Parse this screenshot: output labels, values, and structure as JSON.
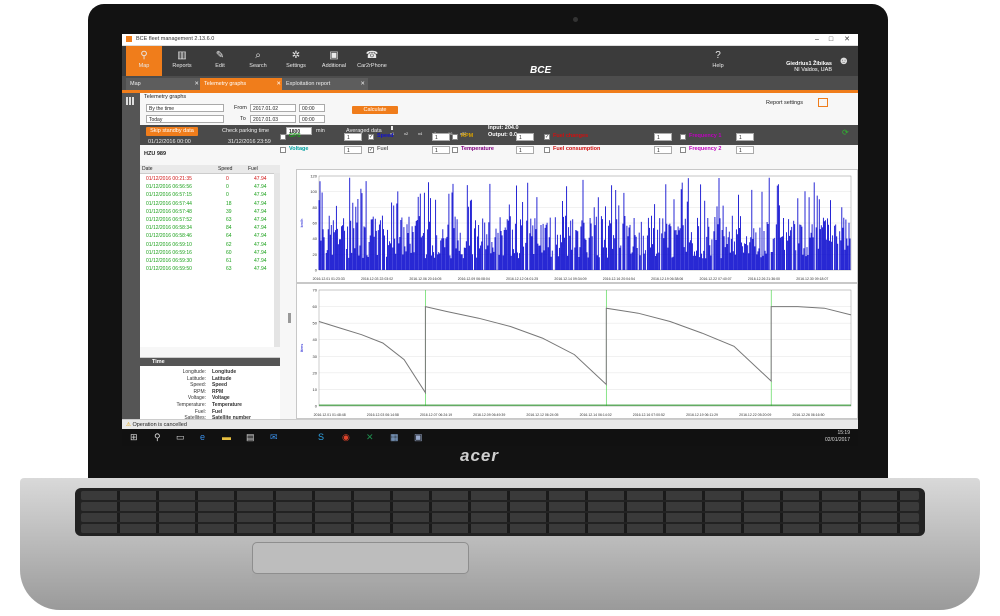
{
  "app": {
    "title": "BCE fleet management 2.13.6.0",
    "brand": "BCE",
    "user_name": "Giedrius1 Žibikas",
    "user_company": "NI Valdos, UAB"
  },
  "ribbon": [
    {
      "label": "Map",
      "icon": "map-pin-icon",
      "glyph": "⚲",
      "active": true
    },
    {
      "label": "Reports",
      "icon": "reports-icon",
      "glyph": "▥"
    },
    {
      "label": "Edit",
      "icon": "edit-icon",
      "glyph": "✎"
    },
    {
      "label": "Search",
      "icon": "search-icon",
      "glyph": "⌕"
    },
    {
      "label": "Settings",
      "icon": "settings-icon",
      "glyph": "✲"
    },
    {
      "label": "Additional",
      "icon": "additional-icon",
      "glyph": "▣"
    },
    {
      "label": "Car2rPhone",
      "icon": "car-phone-icon",
      "glyph": "☎"
    }
  ],
  "help_label": "Help",
  "tabs": [
    {
      "label": "Map",
      "active": false
    },
    {
      "label": "Telemetry graphs",
      "active": true
    },
    {
      "label": "Exploitation report",
      "active": false
    }
  ],
  "controls": {
    "section_title": "Telemetry graphs",
    "mode": "By the time",
    "period": "Today",
    "from_label": "From",
    "to_label": "To",
    "from_date": "2017.01.02",
    "from_time": "00:00",
    "to_date": "2017.01.03",
    "to_time": "00:00",
    "calculate": "Calculate",
    "report_settings": "Report settings",
    "skip_standby": "Skip standby data",
    "check_parking": "Check parking time",
    "parking_value": "1800",
    "parking_unit": "min",
    "averaged": "Averaged data",
    "avg_marks": [
      "x1",
      "x2",
      "x4",
      "x8",
      "x16",
      "x32"
    ],
    "input": "Input: 204.0",
    "output": "Output: 0.0",
    "range_from": "01/12/2016 00:00",
    "range_to": "31/12/2016 23:59"
  },
  "sensors": [
    {
      "name": "GPS",
      "color": "#1a9e1a",
      "checked": false
    },
    {
      "name": "Speed",
      "color": "#1010d0",
      "checked": true
    },
    {
      "name": "RPM",
      "color": "#d8a000",
      "checked": false
    },
    {
      "name": "Fuel changes",
      "color": "#d01010",
      "checked": true
    },
    {
      "name": "Frequency 1",
      "color": "#c000c0",
      "checked": false
    },
    {
      "name": "Voltage",
      "color": "#00a0a0",
      "checked": false
    },
    {
      "name": "Fuel",
      "color": "#666666",
      "checked": true
    },
    {
      "name": "Temperature",
      "color": "#800080",
      "checked": false
    },
    {
      "name": "Fuel consumption",
      "color": "#d01010",
      "checked": false
    },
    {
      "name": "Frequency 2",
      "color": "#c000c0",
      "checked": false
    }
  ],
  "vehicle": "HZU 989",
  "table": {
    "headers": [
      "Date",
      "Speed",
      "Fuel"
    ],
    "rows": [
      {
        "date": "01/12/2016 00:21:35",
        "speed": "0",
        "fuel": "47.94",
        "color": "#d01010"
      },
      {
        "date": "01/12/2016 06:56:56",
        "speed": "0",
        "fuel": "47.94",
        "color": "#18a018"
      },
      {
        "date": "01/12/2016 06:57:15",
        "speed": "0",
        "fuel": "47.94",
        "color": "#18a018"
      },
      {
        "date": "01/12/2016 06:57:44",
        "speed": "18",
        "fuel": "47.94",
        "color": "#18a018"
      },
      {
        "date": "01/12/2016 06:57:48",
        "speed": "39",
        "fuel": "47.94",
        "color": "#18a018"
      },
      {
        "date": "01/12/2016 06:57:52",
        "speed": "63",
        "fuel": "47.94",
        "color": "#18a018"
      },
      {
        "date": "01/12/2016 06:58:34",
        "speed": "84",
        "fuel": "47.94",
        "color": "#18a018"
      },
      {
        "date": "01/12/2016 06:58:46",
        "speed": "64",
        "fuel": "47.94",
        "color": "#18a018"
      },
      {
        "date": "01/12/2016 06:59:10",
        "speed": "62",
        "fuel": "47.94",
        "color": "#18a018"
      },
      {
        "date": "01/12/2016 06:59:16",
        "speed": "60",
        "fuel": "47.94",
        "color": "#18a018"
      },
      {
        "date": "01/12/2016 06:59:30",
        "speed": "61",
        "fuel": "47.94",
        "color": "#18a018"
      },
      {
        "date": "01/12/2016 06:59:50",
        "speed": "63",
        "fuel": "47.94",
        "color": "#18a018"
      }
    ]
  },
  "info": {
    "header": "Time",
    "items": [
      {
        "k": "Longitude:",
        "v": "Longitude"
      },
      {
        "k": "Latitude:",
        "v": "Latitude"
      },
      {
        "k": "Speed:",
        "v": "Speed"
      },
      {
        "k": "RPM:",
        "v": "RPM"
      },
      {
        "k": "Voltage:",
        "v": "Voltage"
      },
      {
        "k": "Temperature:",
        "v": "Temperature"
      },
      {
        "k": "Fuel:",
        "v": "Fuel"
      },
      {
        "k": "Satellites:",
        "v": "Satellite number"
      }
    ]
  },
  "status": "Operation is cancelled",
  "taskbar": {
    "time": "15:19",
    "date": "02/01/2017"
  },
  "laptop_logo": "acer",
  "chart_data": [
    {
      "type": "line",
      "ylabel": "km/h",
      "ylim": [
        0,
        120
      ],
      "yticks": [
        0,
        20,
        40,
        60,
        80,
        100,
        120
      ],
      "xticks": [
        "2016.12.01 01:23:33",
        "2016.12.03 22:03:02",
        "2016.12.06 20:16:05",
        "2016.12.09 06:08:04",
        "2016.12.12 04:01:25",
        "2016.12.14 09:34:09",
        "2016.12.16 20:04:54",
        "2016.12.19 06:38:06",
        "2016.12.22 07:40:07",
        "2016.12.26 21:36:00",
        "2016.12.30 09:18:07"
      ],
      "series": [
        {
          "color": "#1010d0"
        }
      ]
    },
    {
      "type": "line",
      "ylabel": "litres",
      "ylim": [
        0,
        70
      ],
      "yticks": [
        0,
        10,
        20,
        30,
        40,
        50,
        60,
        70
      ],
      "xticks": [
        "2016.12.01 01:48:48",
        "2016.12.03 06:14:58",
        "2016.12.07 06:24:19",
        "2016.12.09 06:49:39",
        "2016.12.12 06:24:05",
        "2016.12.14 06:14:02",
        "2016.12.16 07:00:52",
        "2016.12.19 06:11:29",
        "2016.12.22 05:20:09",
        "2016.12.26 06:16:50"
      ],
      "refuels": [
        {
          "x": 0.2,
          "from": 8,
          "to": 60
        },
        {
          "x": 0.54,
          "from": 13,
          "to": 59
        },
        {
          "x": 0.85,
          "from": 15,
          "to": 60
        }
      ],
      "fuel_points": [
        [
          0,
          51
        ],
        [
          0.04,
          47
        ],
        [
          0.08,
          43
        ],
        [
          0.12,
          38
        ],
        [
          0.16,
          28
        ],
        [
          0.2,
          8
        ],
        [
          0.2,
          60
        ],
        [
          0.24,
          57
        ],
        [
          0.3,
          53
        ],
        [
          0.36,
          48
        ],
        [
          0.42,
          41
        ],
        [
          0.48,
          31
        ],
        [
          0.54,
          13
        ],
        [
          0.54,
          59
        ],
        [
          0.6,
          56
        ],
        [
          0.66,
          51
        ],
        [
          0.72,
          44
        ],
        [
          0.78,
          36
        ],
        [
          0.85,
          15
        ],
        [
          0.85,
          60
        ],
        [
          0.9,
          60
        ],
        [
          0.95,
          59
        ],
        [
          1,
          55
        ]
      ],
      "series": [
        {
          "color": "#777777"
        }
      ]
    }
  ]
}
